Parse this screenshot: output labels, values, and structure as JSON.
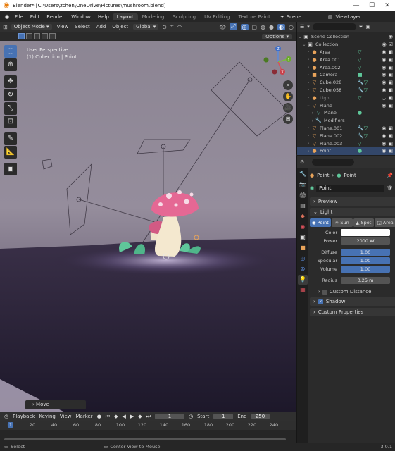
{
  "window": {
    "title": "Blender* [C:\\Users\\zchen\\OneDrive\\Pictures\\mushroom.blend]",
    "minimize": "—",
    "maximize": "☐",
    "close": "✕"
  },
  "menubar": {
    "items": [
      "File",
      "Edit",
      "Render",
      "Window",
      "Help"
    ],
    "tabs": [
      "Layout",
      "Modeling",
      "Sculpting",
      "UV Editing",
      "Texture Paint"
    ],
    "scene": "Scene",
    "view_layer": "ViewLayer"
  },
  "viewport_header": {
    "mode": "Object Mode",
    "menus": [
      "View",
      "Select",
      "Add",
      "Object"
    ],
    "transform_orientation": "Global",
    "options": "Options"
  },
  "viewport": {
    "perspective": "User Perspective",
    "collection_info": "(1) Collection | Point",
    "gizmo_axes": [
      "Z",
      "Y",
      "X"
    ],
    "last_operator": "Move"
  },
  "timeline": {
    "menus": [
      "Playback",
      "Keying",
      "View",
      "Marker"
    ],
    "current_frame": "1",
    "start_label": "Start",
    "start": "1",
    "end_label": "End",
    "end": "250",
    "ruler": [
      "1",
      "20",
      "40",
      "60",
      "80",
      "100",
      "120",
      "140",
      "160",
      "180",
      "200",
      "220",
      "240"
    ]
  },
  "statusbar": {
    "left": "Select",
    "middle": "Center View to Mouse",
    "version": "3.0.1"
  },
  "outliner": {
    "rows": [
      {
        "name": "Scene Collection",
        "icon": "scene-collection-icon",
        "glyph": "▣",
        "color": "#dddddd"
      },
      {
        "name": "Collection",
        "icon": "collection-icon",
        "glyph": "▣",
        "color": "#dddddd"
      },
      {
        "name": "Area",
        "icon": "light-icon",
        "glyph": "●",
        "color": "#e8a35a",
        "mod": "▽"
      },
      {
        "name": "Area.001",
        "icon": "light-icon",
        "glyph": "●",
        "color": "#e8a35a",
        "mod": "▽"
      },
      {
        "name": "Area.002",
        "icon": "light-icon",
        "glyph": "●",
        "color": "#e8a35a",
        "mod": "▽"
      },
      {
        "name": "Camera",
        "icon": "camera-icon",
        "glyph": "■",
        "color": "#e8a35a",
        "mod": "■"
      },
      {
        "name": "Cube.028",
        "icon": "mesh-icon",
        "glyph": "▽",
        "color": "#e8a35a",
        "mod": "🔧▽"
      },
      {
        "name": "Cube.058",
        "icon": "mesh-icon",
        "glyph": "▽",
        "color": "#e8a35a",
        "mod": "🔧▽"
      },
      {
        "name": "Light",
        "icon": "light-icon",
        "glyph": "●",
        "color": "#e8a35a",
        "mod": "▽"
      },
      {
        "name": "Plane",
        "icon": "mesh-icon",
        "glyph": "▽",
        "color": "#e8a35a",
        "mod": ""
      },
      {
        "name": "Plane",
        "icon": "mesh-data-icon",
        "glyph": "▽",
        "color": "#5fb5a4",
        "mod": "●"
      },
      {
        "name": "Modifiers",
        "icon": "wrench-icon",
        "glyph": "🔧",
        "color": "#6fa3d8",
        "mod": ""
      },
      {
        "name": "Plane.001",
        "icon": "mesh-icon",
        "glyph": "▽",
        "color": "#e8a35a",
        "mod": "🔧▽"
      },
      {
        "name": "Plane.002",
        "icon": "mesh-icon",
        "glyph": "▽",
        "color": "#e8a35a",
        "mod": "🔧▽"
      },
      {
        "name": "Plane.003",
        "icon": "mesh-icon",
        "glyph": "▽",
        "color": "#e8a35a",
        "mod": "▽"
      },
      {
        "name": "Point",
        "icon": "light-icon",
        "glyph": "●",
        "color": "#e8a35a",
        "mod": "●"
      }
    ]
  },
  "properties": {
    "breadcrumb": [
      "Point",
      "Point"
    ],
    "datablock": "Point",
    "panels": {
      "preview": "Preview",
      "light": "Light",
      "custom_distance": "Custom Distance",
      "shadow": "Shadow",
      "custom_properties": "Custom Properties"
    },
    "light_types": [
      "Point",
      "Sun",
      "Spot",
      "Area"
    ],
    "fields": {
      "color_label": "Color",
      "power_label": "Power",
      "power": "2000 W",
      "diffuse_label": "Diffuse",
      "diffuse": "1.00",
      "specular_label": "Specular",
      "specular": "1.00",
      "volume_label": "Volume",
      "volume": "1.00",
      "radius_label": "Radius",
      "radius": "0.25 m"
    },
    "light_color": "#ffffff"
  },
  "accent": "#4772b3"
}
